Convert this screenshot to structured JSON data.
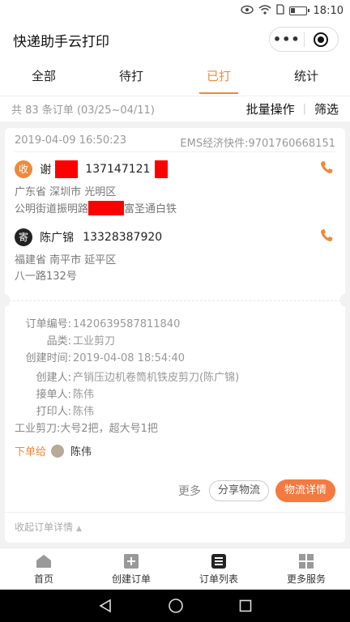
{
  "status_bar": {
    "time": "18:10",
    "icons": [
      "eye-icon",
      "wifi-icon",
      "sim-icon",
      "battery-icon"
    ]
  },
  "app": {
    "title": "快递助手云打印",
    "menu_icon": "more-dots-icon",
    "close_icon": "target-icon"
  },
  "tabs": [
    {
      "label": "全部",
      "active": false
    },
    {
      "label": "待打",
      "active": false
    },
    {
      "label": "已打",
      "active": true
    },
    {
      "label": "统计",
      "active": false
    }
  ],
  "toolbar": {
    "count_text": "共 83 条订单 (03/25~04/11)",
    "batch_label": "批量操作",
    "separator": "|",
    "filter_label": "筛选"
  },
  "order": {
    "datetime": "2019-04-09 16:50:23",
    "carrier_waybill": "EMS经济快件:9701760668151",
    "receiver": {
      "badge": "收",
      "name": "谢",
      "phone": "137147121",
      "province_city": "广东省 深圳市 光明区",
      "street_prefix": "公明街道振明路",
      "street_suffix": "富圣通白铁"
    },
    "sender": {
      "badge": "寄",
      "name": "陈广锦",
      "phone": "13328387920",
      "province_city": "福建省 南平市 延平区",
      "street": "八一路132号"
    },
    "info": {
      "order_no_label": "订单编号:",
      "order_no": "1420639587811840",
      "category_label": "品类:",
      "category": "工业剪刀",
      "created_label": "创建时间:",
      "created": "2019-04-08 18:54:40",
      "creator_label": "创建人:",
      "creator": "产销压边机卷筒机铁皮剪刀(陈广锦)",
      "taker_label": "接单人:",
      "taker": "陈伟",
      "printer_label": "打印人:",
      "printer": "陈伟",
      "cargo": "工业剪刀:大号2把，超大号1把",
      "assign_label": "下单给",
      "assignee": "陈伟"
    },
    "actions": {
      "more": "更多",
      "share": "分享物流",
      "detail": "物流详情"
    },
    "collapse_label": "收起订单详情"
  },
  "bottom_tabs": [
    {
      "label": "首页",
      "icon": "home-icon"
    },
    {
      "label": "创建订单",
      "icon": "add-order-icon"
    },
    {
      "label": "订单列表",
      "icon": "list-icon"
    },
    {
      "label": "更多服务",
      "icon": "grid-icon"
    }
  ],
  "colors": {
    "accent": "#f0893a",
    "primary_button": "#f47a3f",
    "redaction": "#ff0000"
  }
}
